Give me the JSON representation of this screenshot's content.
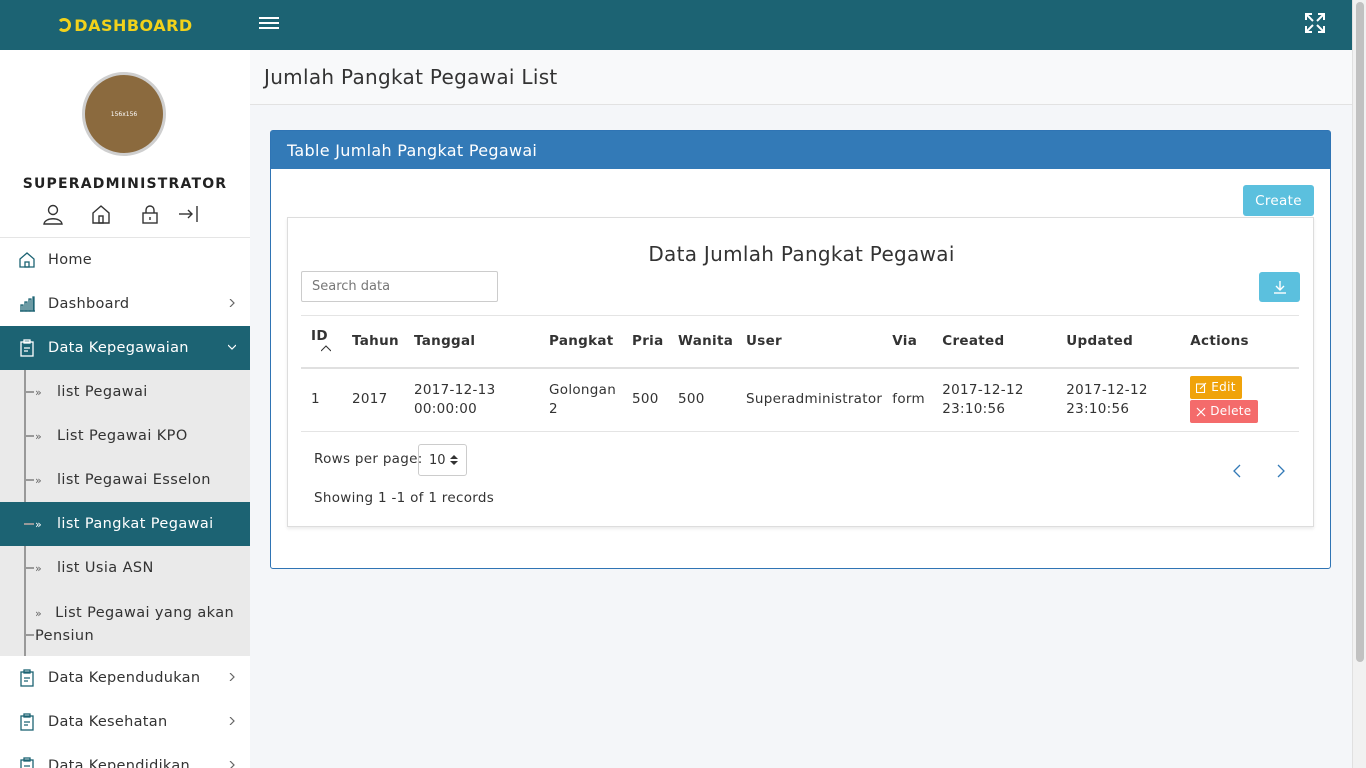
{
  "brand": {
    "name": "DASHBOARD"
  },
  "colors": {
    "primary": "#1c6373",
    "accent": "#f2d21b",
    "card_header": "#337ab7",
    "info_button": "#5bc0de",
    "edit": "#f0a30a",
    "delete": "#f46b6b"
  },
  "profile": {
    "avatar_text": "156x156",
    "username": "SUPERADMINISTRATOR"
  },
  "sidebar": {
    "items": [
      {
        "label": "Home",
        "icon": "home-icon"
      },
      {
        "label": "Dashboard",
        "icon": "bar-chart-icon"
      },
      {
        "label": "Data Kepegawaian",
        "icon": "clipboard-icon"
      },
      {
        "label": "Data Kependudukan",
        "icon": "clipboard-icon"
      },
      {
        "label": "Data Kesehatan",
        "icon": "clipboard-icon"
      },
      {
        "label": "Data Kependidikan",
        "icon": "clipboard-icon"
      }
    ],
    "submenu": [
      {
        "label": "list Pegawai"
      },
      {
        "label": "List Pegawai KPO"
      },
      {
        "label": "list Pegawai Esselon"
      },
      {
        "label": "list Pangkat Pegawai"
      },
      {
        "label": "list Usia ASN"
      },
      {
        "label": "List Pegawai yang akan Pensiun"
      }
    ]
  },
  "page": {
    "title": "Jumlah Pangkat Pegawai List"
  },
  "card": {
    "title": "Table Jumlah Pangkat Pegawai",
    "create_label": "Create"
  },
  "table": {
    "title": "Data Jumlah Pangkat Pegawai",
    "search_placeholder": "Search data",
    "columns": [
      "ID",
      "Tahun",
      "Tanggal",
      "Pangkat",
      "Pria",
      "Wanita",
      "User",
      "Via",
      "Created",
      "Updated",
      "Actions"
    ],
    "rows": [
      {
        "id": "1",
        "tahun": "2017",
        "tanggal_date": "2017-12-13",
        "tanggal_time": "00:00:00",
        "pangkat_1": "Golongan",
        "pangkat_2": "2",
        "pria": "500",
        "wanita": "500",
        "user": "Superadministrator",
        "via": "form",
        "created_date": "2017-12-12",
        "created_time": "23:10:56",
        "updated_date": "2017-12-12",
        "updated_time": "23:10:56",
        "edit_label": "Edit",
        "delete_label": "Delete"
      }
    ],
    "rows_per_page_label": "Rows per page:",
    "rows_per_page_value": "10",
    "showing_text": "Showing 1 -1 of 1 records"
  }
}
